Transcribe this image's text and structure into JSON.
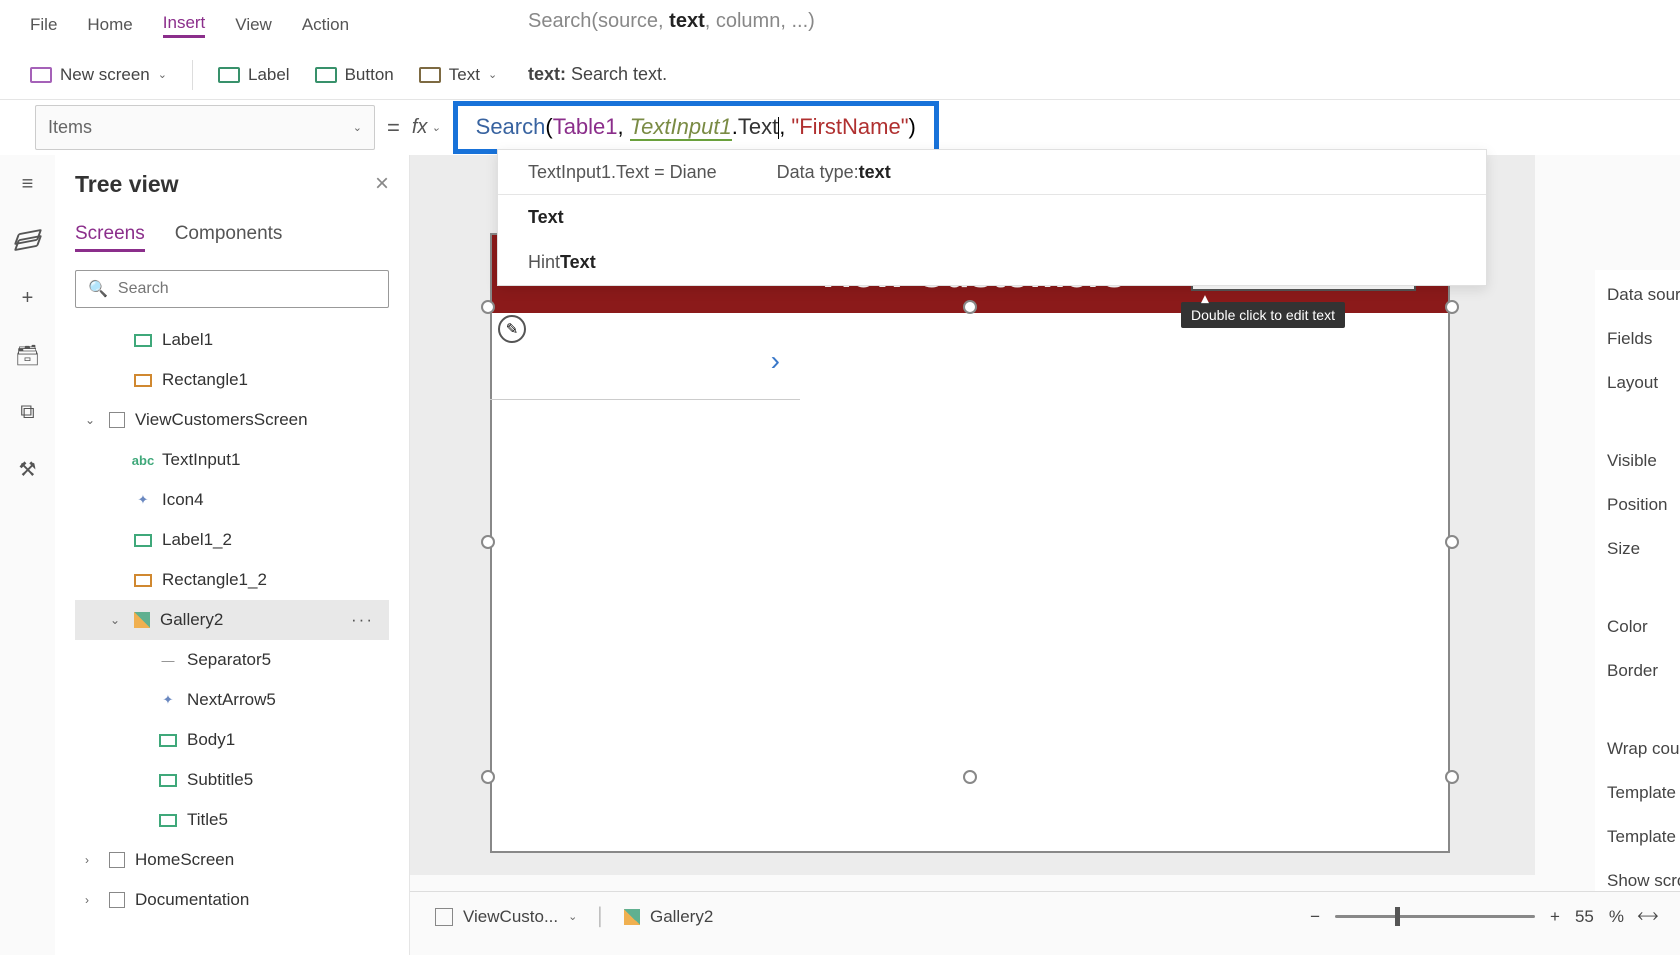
{
  "menu": {
    "file": "File",
    "home": "Home",
    "insert": "Insert",
    "view": "View",
    "action": "Action"
  },
  "searchSig": {
    "pre": "Search(source, ",
    "bold": "text",
    "post": ", column, ...)"
  },
  "toolbar": {
    "newscreen": "New screen",
    "label": "Label",
    "button": "Button",
    "text": "Text"
  },
  "texthint": {
    "bold": "text:",
    "rest": " Search text."
  },
  "prop": "Items",
  "formula": {
    "func": "Search",
    "open": "(",
    "table": "Table1",
    "comma1": ", ",
    "var": "TextInput1",
    "dot": ".",
    "prop": "Text",
    "comma2": ", ",
    "q1": "\"",
    "str": "FirstName",
    "q2": "\"",
    "close": ")"
  },
  "intel": {
    "lhs": "TextInput1.Text  =  Diane",
    "dt_lbl": "Data type: ",
    "dt_val": "text",
    "opt1_pre": "",
    "opt1_bold": "Text",
    "opt2_pre": "Hint",
    "opt2_bold": "Text"
  },
  "tree": {
    "title": "Tree view",
    "tabs": {
      "screens": "Screens",
      "components": "Components"
    },
    "search_ph": "Search",
    "items": [
      {
        "name": "Label1",
        "icon": "label",
        "d": 1
      },
      {
        "name": "Rectangle1",
        "icon": "rect",
        "d": 1
      },
      {
        "name": "ViewCustomersScreen",
        "icon": "chk",
        "d": 0,
        "expand": "open"
      },
      {
        "name": "TextInput1",
        "icon": "txt",
        "d": 1
      },
      {
        "name": "Icon4",
        "icon": "icon",
        "d": 1
      },
      {
        "name": "Label1_2",
        "icon": "label",
        "d": 1
      },
      {
        "name": "Rectangle1_2",
        "icon": "rect",
        "d": 1
      },
      {
        "name": "Gallery2",
        "icon": "gal",
        "d": 1,
        "expand": "open",
        "sel": true
      },
      {
        "name": "Separator5",
        "icon": "sep",
        "d": 2
      },
      {
        "name": "NextArrow5",
        "icon": "icon",
        "d": 2
      },
      {
        "name": "Body1",
        "icon": "label",
        "d": 2
      },
      {
        "name": "Subtitle5",
        "icon": "label",
        "d": 2
      },
      {
        "name": "Title5",
        "icon": "label",
        "d": 2
      },
      {
        "name": "HomeScreen",
        "icon": "chk",
        "d": 0,
        "expand": "closed"
      },
      {
        "name": "Documentation",
        "icon": "chk",
        "d": 0,
        "expand": "closed"
      }
    ]
  },
  "canvas": {
    "title": "View Customers",
    "tooltip": "Double click to edit text"
  },
  "right": [
    "Data source",
    "Fields",
    "Layout",
    "Visible",
    "Position",
    "Size",
    "Color",
    "Border",
    "Wrap count",
    "Template size",
    "Template pa",
    "Show scroll"
  ],
  "status": {
    "bc1": "ViewCusto...",
    "bc2": "Gallery2",
    "zoom": "55",
    "pct": "%"
  }
}
